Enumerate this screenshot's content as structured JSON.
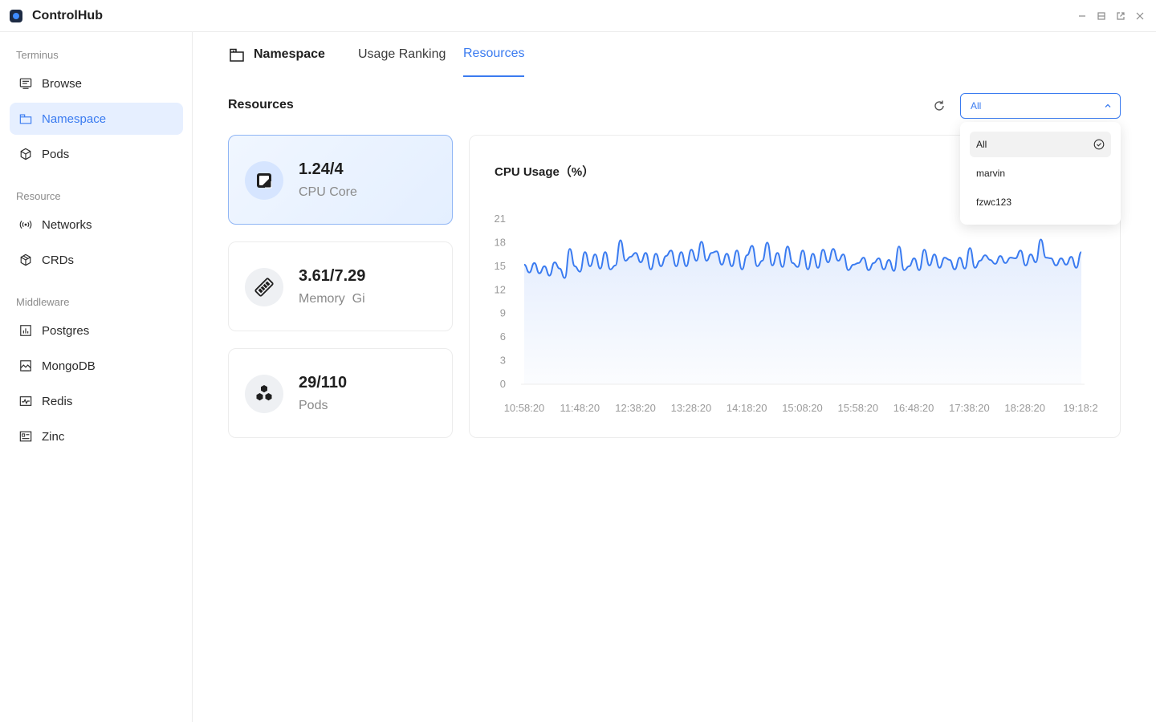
{
  "app": {
    "title": "ControlHub"
  },
  "sidebar": {
    "sections": [
      {
        "title": "Terminus",
        "items": [
          {
            "label": "Browse",
            "icon": "browse-icon"
          },
          {
            "label": "Namespace",
            "icon": "namespace-icon",
            "active": true
          },
          {
            "label": "Pods",
            "icon": "cube-icon"
          }
        ]
      },
      {
        "title": "Resource",
        "items": [
          {
            "label": "Networks",
            "icon": "broadcast-icon"
          },
          {
            "label": "CRDs",
            "icon": "box-icon"
          }
        ]
      },
      {
        "title": "Middleware",
        "items": [
          {
            "label": "Postgres",
            "icon": "chart-icon"
          },
          {
            "label": "MongoDB",
            "icon": "image-icon"
          },
          {
            "label": "Redis",
            "icon": "pulse-icon"
          },
          {
            "label": "Zinc",
            "icon": "list-icon"
          }
        ]
      }
    ]
  },
  "tabs": {
    "title": "Namespace",
    "items": [
      "Usage Ranking",
      "Resources"
    ],
    "active": "Resources"
  },
  "resources": {
    "title": "Resources",
    "filter": {
      "selected": "All",
      "options": [
        "All",
        "marvin",
        "fzwc123"
      ]
    },
    "cards": [
      {
        "value": "1.24/4",
        "label": "CPU Core",
        "icon": "cpu-icon"
      },
      {
        "value": "3.61/7.29",
        "label": "Memory  Gi",
        "icon": "memory-icon"
      },
      {
        "value": "29/110",
        "label": "Pods",
        "icon": "pods-icon"
      }
    ]
  },
  "chart_data": {
    "type": "area",
    "title": "CPU Usage（%）",
    "ylim": [
      0,
      21
    ],
    "yticks": [
      "0",
      "3",
      "6",
      "9",
      "12",
      "15",
      "18",
      "21"
    ],
    "xticks": [
      "10:58:20",
      "11:48:20",
      "12:38:20",
      "13:28:20",
      "14:18:20",
      "15:08:20",
      "15:58:20",
      "16:48:20",
      "17:38:20",
      "18:28:20",
      "19:18:2"
    ],
    "color": "#3a7bf0",
    "values": [
      15.2,
      14.2,
      15.4,
      14.1,
      15.0,
      13.8,
      15.5,
      14.7,
      13.5,
      17.2,
      15.0,
      14.3,
      16.8,
      15.0,
      16.5,
      14.7,
      16.8,
      14.6,
      15.1,
      18.3,
      15.7,
      16.2,
      16.7,
      15.5,
      16.7,
      14.6,
      16.6,
      15.0,
      16.3,
      17.0,
      15.0,
      16.8,
      15.0,
      17.1,
      15.7,
      18.1,
      15.7,
      16.7,
      16.9,
      15.2,
      16.6,
      15.0,
      17.0,
      14.6,
      16.4,
      17.6,
      15.0,
      15.7,
      18.0,
      15.1,
      16.7,
      14.9,
      17.5,
      15.4,
      14.9,
      17.0,
      14.6,
      16.6,
      14.8,
      17.1,
      15.5,
      17.2,
      15.7,
      16.5,
      14.5,
      15.2,
      15.4,
      16.1,
      14.5,
      15.4,
      16.0,
      14.6,
      15.8,
      14.4,
      17.5,
      14.5,
      15.0,
      16.0,
      14.5,
      17.1,
      15.1,
      16.5,
      14.8,
      16.1,
      15.8,
      14.6,
      16.1,
      14.7,
      17.3,
      14.8,
      15.7,
      16.4,
      15.8,
      15.3,
      16.3,
      15.4,
      16.1,
      16.0,
      17.0,
      15.1,
      16.5,
      15.5,
      18.4,
      16.1,
      16.0,
      15.1,
      16.0,
      15.2,
      16.2,
      14.8,
      16.8
    ]
  }
}
